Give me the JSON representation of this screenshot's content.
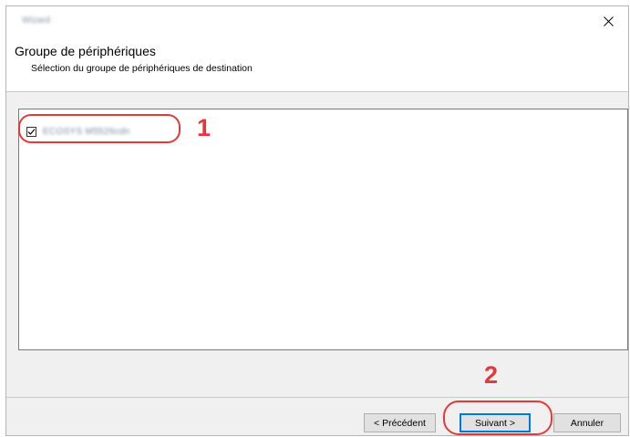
{
  "window": {
    "title": "Wizard",
    "close_label": "×"
  },
  "header": {
    "title": "Groupe de périphériques",
    "subtitle": "Sélection du groupe de périphériques de destination"
  },
  "list": {
    "items": [
      {
        "label": "ECOSYS M5526cdn",
        "checked": true
      }
    ]
  },
  "callouts": {
    "one": "1",
    "two": "2"
  },
  "buttons": {
    "back_label": "< Précédent",
    "next_label": "Suivant >",
    "cancel_label": "Annuler"
  },
  "colors": {
    "highlight": "#e23a3a",
    "default_button_border": "#0078d7"
  }
}
